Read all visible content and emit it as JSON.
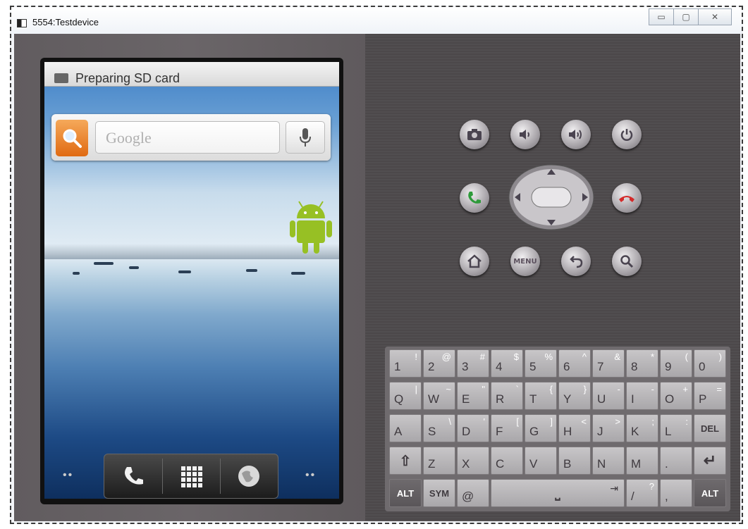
{
  "window": {
    "title": "5554:Testdevice",
    "controls": {
      "minimize": "▭",
      "maximize": "▢",
      "close": "✕"
    }
  },
  "screen": {
    "notification": "Preparing SD card",
    "search_placeholder": "Google",
    "dock": {
      "phone": "phone-icon",
      "apps": "app-grid-icon",
      "browser": "globe-icon"
    },
    "page_dots_left": "••",
    "page_dots_right": "••"
  },
  "controls": {
    "menu_label": "MENU"
  },
  "keyboard": {
    "row1": [
      {
        "main": "1",
        "alt": "!"
      },
      {
        "main": "2",
        "alt": "@"
      },
      {
        "main": "3",
        "alt": "#"
      },
      {
        "main": "4",
        "alt": "$"
      },
      {
        "main": "5",
        "alt": "%"
      },
      {
        "main": "6",
        "alt": "^"
      },
      {
        "main": "7",
        "alt": "&"
      },
      {
        "main": "8",
        "alt": "*"
      },
      {
        "main": "9",
        "alt": "("
      },
      {
        "main": "0",
        "alt": ")"
      }
    ],
    "row2": [
      {
        "main": "Q",
        "alt": "|"
      },
      {
        "main": "W",
        "alt": "~"
      },
      {
        "main": "E",
        "alt": "\""
      },
      {
        "main": "R",
        "alt": "`"
      },
      {
        "main": "T",
        "alt": "{"
      },
      {
        "main": "Y",
        "alt": "}"
      },
      {
        "main": "U",
        "alt": "-"
      },
      {
        "main": "I",
        "alt": "-"
      },
      {
        "main": "O",
        "alt": "+"
      },
      {
        "main": "P",
        "alt": "="
      }
    ],
    "row3": [
      {
        "main": "A",
        "alt": ""
      },
      {
        "main": "S",
        "alt": "\\"
      },
      {
        "main": "D",
        "alt": "'"
      },
      {
        "main": "F",
        "alt": "["
      },
      {
        "main": "G",
        "alt": "]"
      },
      {
        "main": "H",
        "alt": "<"
      },
      {
        "main": "J",
        "alt": ">"
      },
      {
        "main": "K",
        "alt": ";"
      },
      {
        "main": "L",
        "alt": ":"
      },
      {
        "main": "DEL",
        "alt": ""
      }
    ],
    "row4": [
      {
        "main": "⇧",
        "alt": ""
      },
      {
        "main": "Z",
        "alt": ""
      },
      {
        "main": "X",
        "alt": ""
      },
      {
        "main": "C",
        "alt": ""
      },
      {
        "main": "V",
        "alt": ""
      },
      {
        "main": "B",
        "alt": ""
      },
      {
        "main": "N",
        "alt": ""
      },
      {
        "main": "M",
        "alt": ""
      },
      {
        "main": ".",
        "alt": ""
      },
      {
        "main": "↵",
        "alt": ""
      }
    ],
    "row5": {
      "alt_left": "ALT",
      "sym": "SYM",
      "at": "@",
      "space": "⎵",
      "slash": "/",
      "question": "?",
      "comma": ",",
      "tab": "⇥",
      "alt_right": "ALT"
    }
  }
}
